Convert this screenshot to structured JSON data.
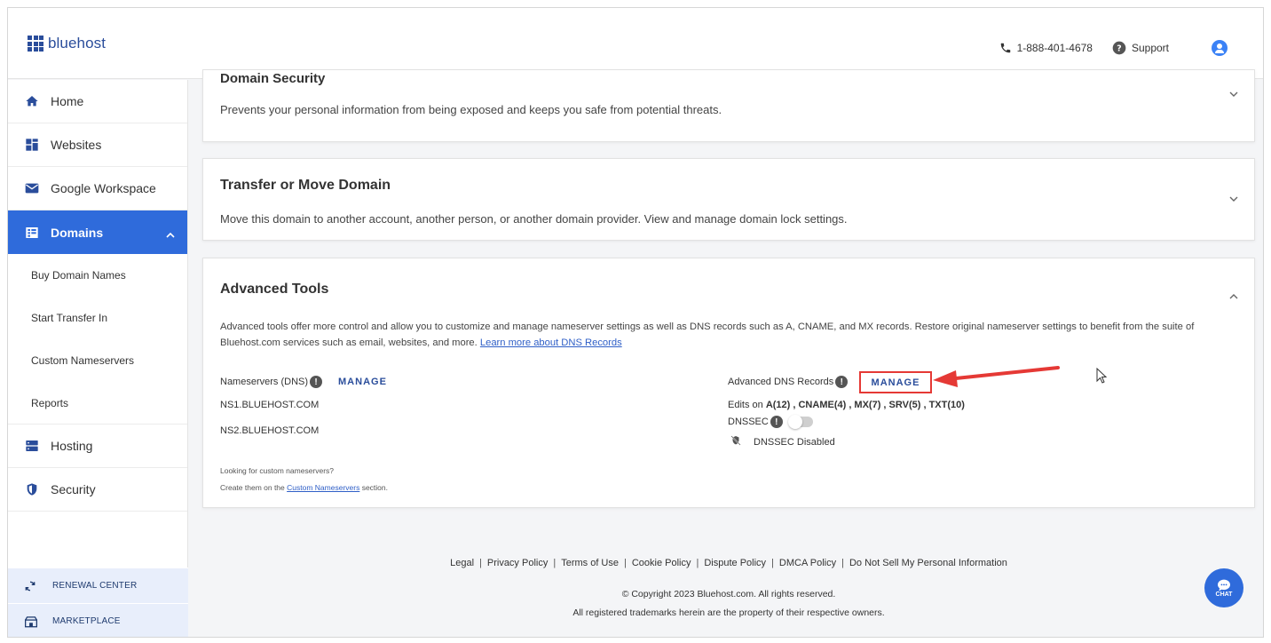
{
  "brand": {
    "name": "bluehost",
    "color": "#2a4d9b"
  },
  "header": {
    "phone": "1-888-401-4678",
    "support": "Support"
  },
  "sidebar": {
    "items": [
      {
        "label": "Home",
        "icon": "home-icon"
      },
      {
        "label": "Websites",
        "icon": "websites-icon"
      },
      {
        "label": "Google Workspace",
        "icon": "mail-icon"
      },
      {
        "label": "Domains",
        "icon": "domains-icon",
        "active": true
      },
      {
        "label": "Hosting",
        "icon": "hosting-icon"
      },
      {
        "label": "Security",
        "icon": "shield-icon"
      }
    ],
    "sub_items": [
      "Buy Domain Names",
      "Start Transfer In",
      "Custom Nameservers",
      "Reports"
    ],
    "bottom": [
      {
        "label": "RENEWAL CENTER",
        "icon": "renew-icon"
      },
      {
        "label": "MARKETPLACE",
        "icon": "marketplace-icon"
      }
    ],
    "active_color": "#2f6bdb"
  },
  "cards": {
    "security": {
      "title": "Domain Security",
      "desc": "Prevents your personal information from being exposed and keeps you safe from potential threats."
    },
    "transfer": {
      "title": "Transfer or Move Domain",
      "desc": "Move this domain to another account, another person, or another domain provider. View and manage domain lock settings."
    },
    "advanced": {
      "title": "Advanced Tools",
      "desc": "Advanced tools offer more control and allow you to customize and manage nameserver settings as well as DNS records such as A, CNAME, and MX records. Restore original nameserver settings to benefit from the suite of Bluehost.com services such as email, websites, and more.",
      "learn_more": "Learn more about DNS Records",
      "ns_label": "Nameservers (DNS)",
      "ns_manage": "MANAGE",
      "ns1": "NS1.BLUEHOST.COM",
      "ns2": "NS2.BLUEHOST.COM",
      "custom_q": "Looking for custom nameservers?",
      "custom_pre": "Create them on the",
      "custom_link": "Custom Nameservers",
      "custom_post": "section.",
      "dns_label": "Advanced DNS Records",
      "dns_manage": "MANAGE",
      "edits_pre": "Edits on",
      "edits_records": "A(12) , CNAME(4) , MX(7) , SRV(5) , TXT(10)",
      "dnssec_label": "DNSSEC",
      "dnssec_status": "DNSSEC Disabled"
    }
  },
  "footer": {
    "links": [
      "Legal",
      "Privacy Policy",
      "Terms of Use",
      "Cookie Policy",
      "Dispute Policy",
      "DMCA Policy",
      "Do Not Sell My Personal Information"
    ],
    "copyright": "© Copyright 2023 Bluehost.com. All rights reserved.",
    "trademarks": "All registered trademarks herein are the property of their respective owners."
  },
  "chat": {
    "label": "CHAT"
  },
  "annotation_color": "#e53935"
}
